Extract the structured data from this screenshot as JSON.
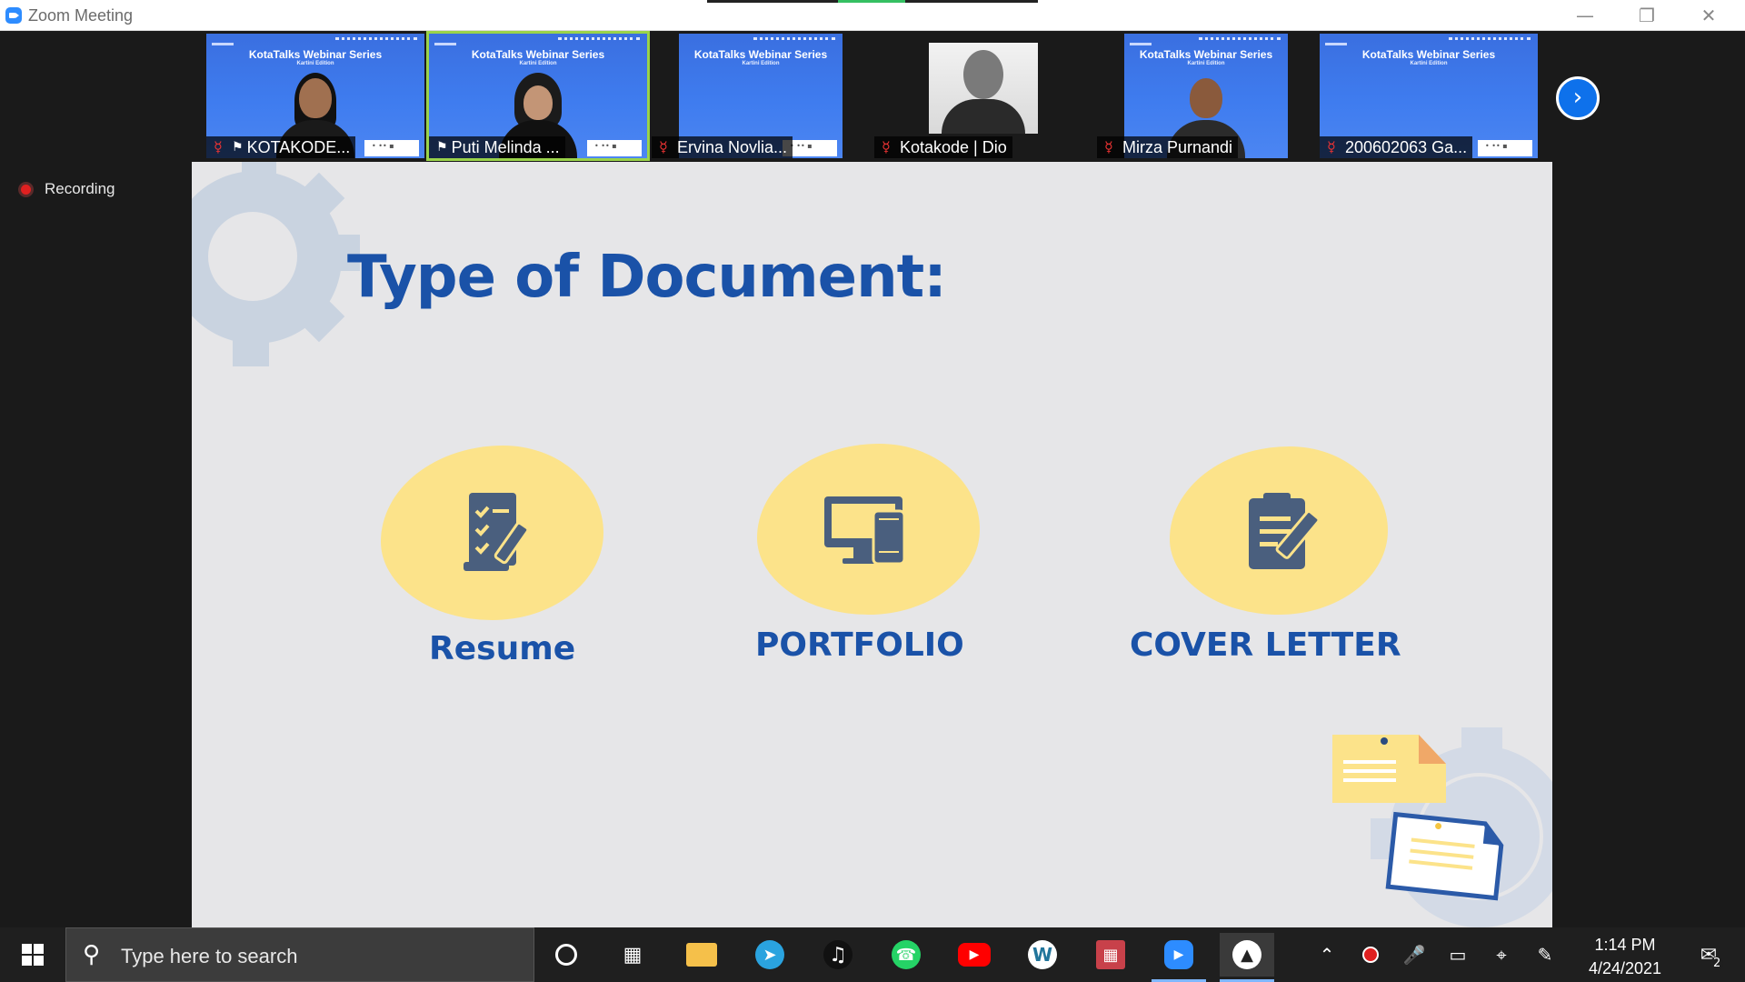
{
  "window": {
    "title": "Zoom Meeting",
    "controls": [
      "minimize",
      "restore",
      "close"
    ]
  },
  "recording": {
    "label": "Recording"
  },
  "participants": [
    {
      "name": "KOTAKODE...",
      "muted": true,
      "pinned": true,
      "banner": "KotaTalks Webinar Series",
      "sub": "Kartini Edition"
    },
    {
      "name": "Puti Melinda ...",
      "muted": false,
      "pinned": true,
      "active_speaker": true,
      "banner": "KotaTalks Webinar Series",
      "sub": "Kartini Edition"
    },
    {
      "name": "Ervina Novlia...",
      "muted": true,
      "banner": "KotaTalks Webinar Series",
      "sub": "Kartini Edition"
    },
    {
      "name": "Kotakode | Dio",
      "muted": true
    },
    {
      "name": "Mirza Purnandi",
      "muted": true,
      "banner": "KotaTalks Webinar Series",
      "sub": "Kartini Edition"
    },
    {
      "name": "200602063 Ga...",
      "muted": true,
      "banner": "KotaTalks Webinar Series",
      "sub": "Kartini Edition"
    }
  ],
  "slide": {
    "title": "Type of Document:",
    "items": [
      {
        "label": "Resume",
        "icon": "resume-checklist-icon"
      },
      {
        "label": "PORTFOLIO",
        "icon": "devices-icon"
      },
      {
        "label": "COVER LETTER",
        "icon": "document-edit-icon"
      }
    ],
    "colors": {
      "title": "#1a52a8",
      "blob": "#fce38a",
      "background": "#e6e6e8",
      "gear": "#c9d3e0"
    }
  },
  "taskbar": {
    "search_placeholder": "Type here to search",
    "apps": [
      "cortana",
      "task-view",
      "file-explorer",
      "telegram",
      "tiktok",
      "whatsapp",
      "youtube",
      "wordpress",
      "app-red",
      "zoom",
      "photos"
    ],
    "time": "1:14 PM",
    "date": "4/24/2021",
    "notifications_count": "2"
  }
}
